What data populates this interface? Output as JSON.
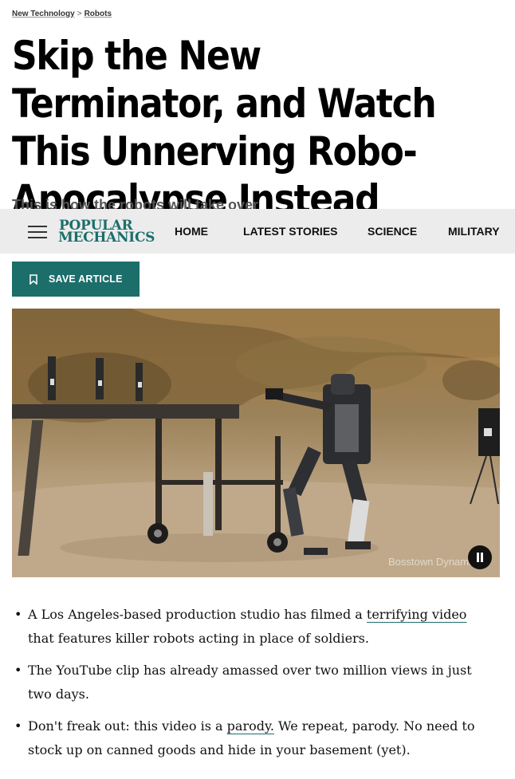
{
  "breadcrumb": {
    "section": "New Technology",
    "separator": ">",
    "subsection": "Robots"
  },
  "article": {
    "headline": "Skip the New Terminator, and Watch This Unnerving Robo-Apocalypse Instead",
    "dek": "This is how the robots will take over"
  },
  "nav": {
    "logo_line1": "POPULAR",
    "logo_line2": "MECHANICS",
    "items": [
      "HOME",
      "LATEST STORIES",
      "SCIENCE",
      "MILITARY"
    ]
  },
  "save_button": {
    "label": "SAVE ARTICLE"
  },
  "video": {
    "watermark": "Bosstown Dynami"
  },
  "bullets": [
    {
      "before": "A Los Angeles-based production studio has filmed a ",
      "link": "terrifying video",
      "after": " that features killer robots acting in place of soldiers."
    },
    {
      "text": "The YouTube clip has already amassed over two million views in just two days."
    },
    {
      "before": "Don't freak out: this video is a ",
      "link": "parody.",
      "after": " We repeat, parody. No need to stock up on canned goods and hide in your basement (yet)."
    }
  ],
  "colors": {
    "brand": "#1c6e6b",
    "nav_bg": "#ececec"
  }
}
